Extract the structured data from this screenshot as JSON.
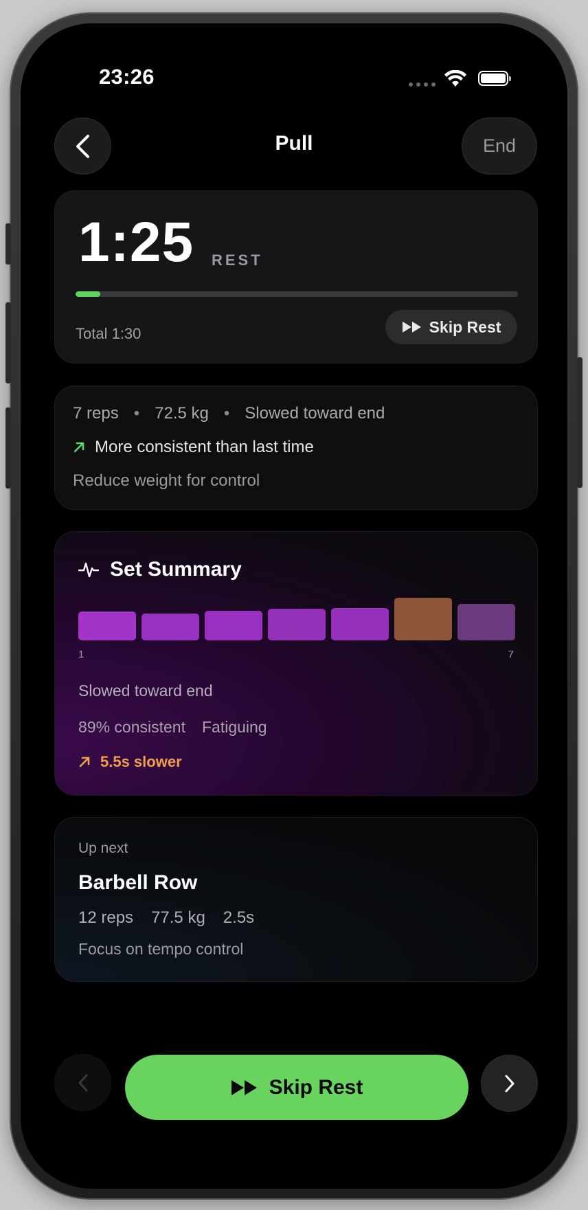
{
  "status_bar": {
    "time": "23:26"
  },
  "header": {
    "title": "Pull",
    "end_label": "End"
  },
  "timer": {
    "value": "1:25",
    "label": "REST",
    "progress": 0.056,
    "total_label": "Total 1:30",
    "skip_label": "Skip Rest"
  },
  "last_set": {
    "reps": "7 reps",
    "weight": "72.5 kg",
    "note": "Slowed toward end",
    "trend": "More consistent than last time",
    "advice": "Reduce weight for control",
    "colors": {
      "trend_arrow": "#5fd35e"
    }
  },
  "summary": {
    "title": "Set Summary",
    "icon": "pulse-icon",
    "rep_bars": [
      {
        "rep": 1,
        "value": 0.68,
        "color": "#a235c8"
      },
      {
        "rep": 2,
        "value": 0.63,
        "color": "#9a30c0"
      },
      {
        "rep": 3,
        "value": 0.7,
        "color": "#9a30c0"
      },
      {
        "rep": 4,
        "value": 0.74,
        "color": "#9530b8"
      },
      {
        "rep": 5,
        "value": 0.76,
        "color": "#9630bc"
      },
      {
        "rep": 6,
        "value": 1.0,
        "color": "#8e5638"
      },
      {
        "rep": 7,
        "value": 0.85,
        "color": "#6a3a7e"
      }
    ],
    "axis_min": "1",
    "axis_max": "7",
    "note": "Slowed toward end",
    "consistency": "89% consistent",
    "state": "Fatiguing",
    "delta": "5.5s slower",
    "colors": {
      "delta": "#f0a04b"
    }
  },
  "up_next": {
    "label": "Up next",
    "exercise": "Barbell Row",
    "reps": "12 reps",
    "weight": "77.5 kg",
    "tempo": "2.5s",
    "focus": "Focus on tempo control"
  },
  "footer": {
    "primary_label": "Skip Rest",
    "accent": "#68d45f"
  }
}
